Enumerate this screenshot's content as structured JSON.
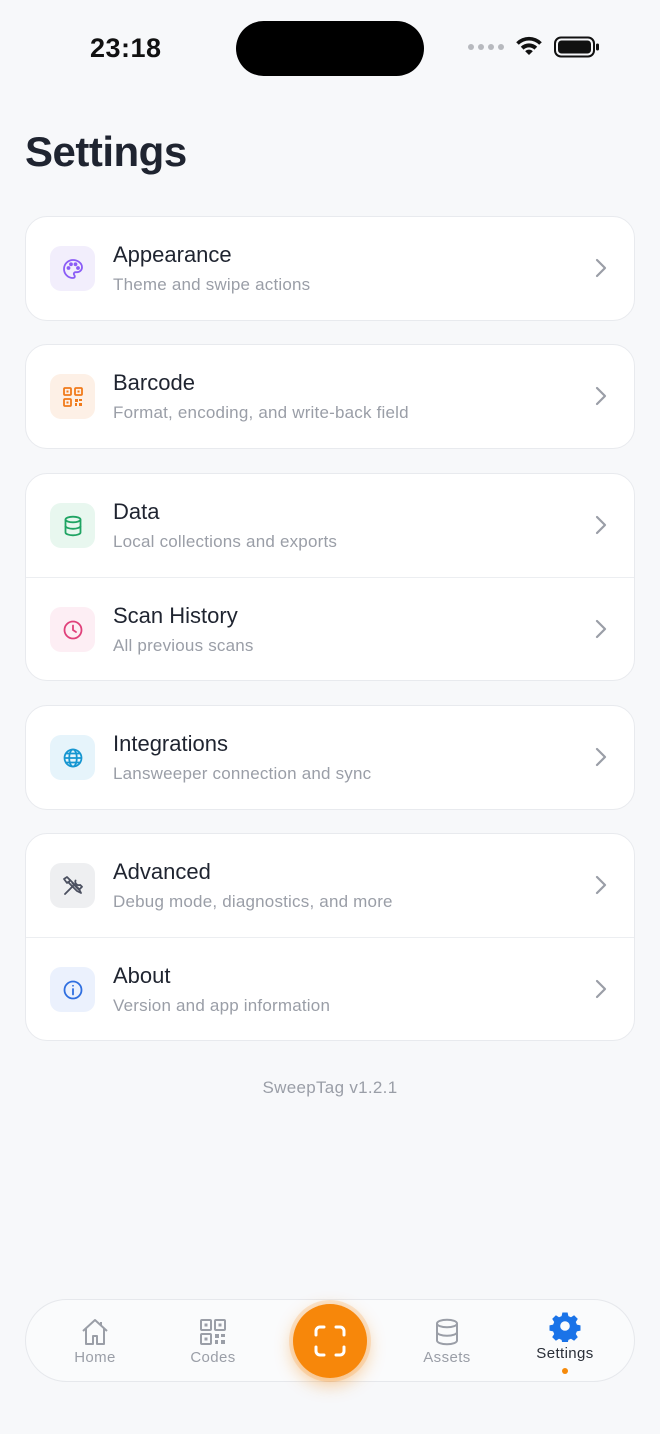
{
  "status_bar": {
    "time": "23:18"
  },
  "page": {
    "title": "Settings",
    "version": "SweepTag v1.2.1"
  },
  "colors": {
    "accent": "#f7870a",
    "active_tab": "#1a73e8"
  },
  "groups": [
    {
      "items": [
        {
          "title": "Appearance",
          "subtitle": "Theme and swipe actions",
          "icon": "palette-icon"
        }
      ]
    },
    {
      "items": [
        {
          "title": "Barcode",
          "subtitle": "Format, encoding, and write-back field",
          "icon": "qr-code-icon"
        }
      ]
    },
    {
      "items": [
        {
          "title": "Data",
          "subtitle": "Local collections and exports",
          "icon": "database-icon"
        },
        {
          "title": "Scan History",
          "subtitle": "All previous scans",
          "icon": "clock-icon"
        }
      ]
    },
    {
      "items": [
        {
          "title": "Integrations",
          "subtitle": "Lansweeper connection and sync",
          "icon": "globe-icon"
        }
      ]
    },
    {
      "items": [
        {
          "title": "Advanced",
          "subtitle": "Debug mode, diagnostics, and more",
          "icon": "tools-icon"
        },
        {
          "title": "About",
          "subtitle": "Version and app information",
          "icon": "info-icon"
        }
      ]
    }
  ],
  "tabbar": {
    "home": "Home",
    "codes": "Codes",
    "assets": "Assets",
    "settings": "Settings",
    "active": "settings"
  }
}
